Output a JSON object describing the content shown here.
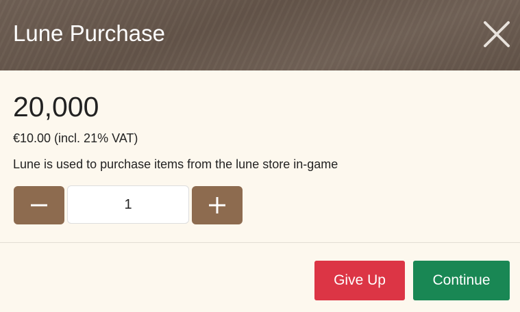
{
  "dialog": {
    "title": "Lune Purchase",
    "close_icon": "close-icon"
  },
  "product": {
    "amount": "20,000",
    "price": "€10.00 (incl. 21% VAT)",
    "description": "Lune is used to purchase items from the lune store in-game"
  },
  "quantity": {
    "value": "1",
    "decrement_icon": "minus-icon",
    "increment_icon": "plus-icon"
  },
  "actions": {
    "give_up_label": "Give Up",
    "continue_label": "Continue"
  },
  "colors": {
    "header_bg": "#6a5a4e",
    "body_bg": "#fdf8ee",
    "stepper_bg": "#8d6b4f",
    "give_up_bg": "#dc3545",
    "continue_bg": "#198754"
  }
}
